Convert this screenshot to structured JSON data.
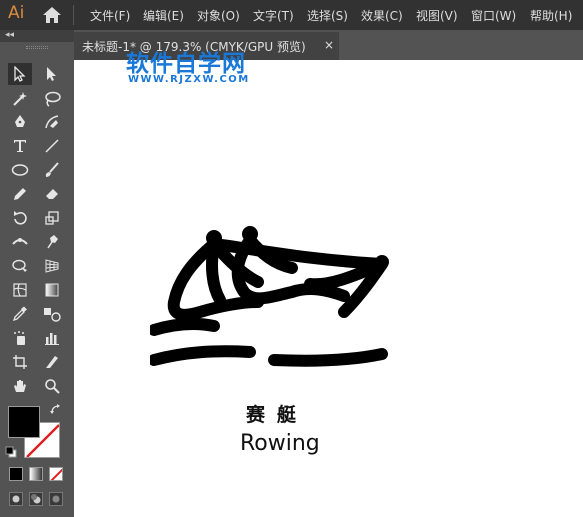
{
  "app": {
    "logo_text": "Ai",
    "menus": [
      "文件(F)",
      "编辑(E)",
      "对象(O)",
      "文字(T)",
      "选择(S)",
      "效果(C)",
      "视图(V)",
      "窗口(W)",
      "帮助(H)"
    ]
  },
  "document": {
    "tab_title": "未标题-1* @ 179.3% (CMYK/GPU 预览)",
    "close_glyph": "×"
  },
  "toolbar": {
    "collapse_glyph": "◂◂",
    "tools": [
      [
        "selection-tool-icon",
        "direct-selection-tool-icon"
      ],
      [
        "magic-wand-tool-icon",
        "lasso-tool-icon"
      ],
      [
        "pen-tool-icon",
        "curvature-tool-icon"
      ],
      [
        "type-tool-icon",
        "line-segment-tool-icon"
      ],
      [
        "ellipse-tool-icon",
        "paintbrush-tool-icon"
      ],
      [
        "pencil-tool-icon",
        "eraser-tool-icon"
      ],
      [
        "rotate-tool-icon",
        "scale-tool-icon"
      ],
      [
        "width-tool-icon",
        "puppet-warp-tool-icon"
      ],
      [
        "shape-builder-tool-icon",
        "perspective-grid-tool-icon"
      ],
      [
        "mesh-tool-icon",
        "gradient-tool-icon"
      ],
      [
        "eyedropper-tool-icon",
        "blend-tool-icon"
      ],
      [
        "symbol-sprayer-tool-icon",
        "column-graph-tool-icon"
      ],
      [
        "artboard-tool-icon",
        "slice-tool-icon"
      ],
      [
        "hand-tool-icon",
        "zoom-tool-icon"
      ]
    ],
    "fill_color": "#000000",
    "stroke_color": "none"
  },
  "artwork": {
    "title_zh": "赛艇",
    "title_en": "Rowing"
  },
  "watermark": {
    "main": "软件自学网",
    "sub": "WWW.RJZXW.COM"
  }
}
